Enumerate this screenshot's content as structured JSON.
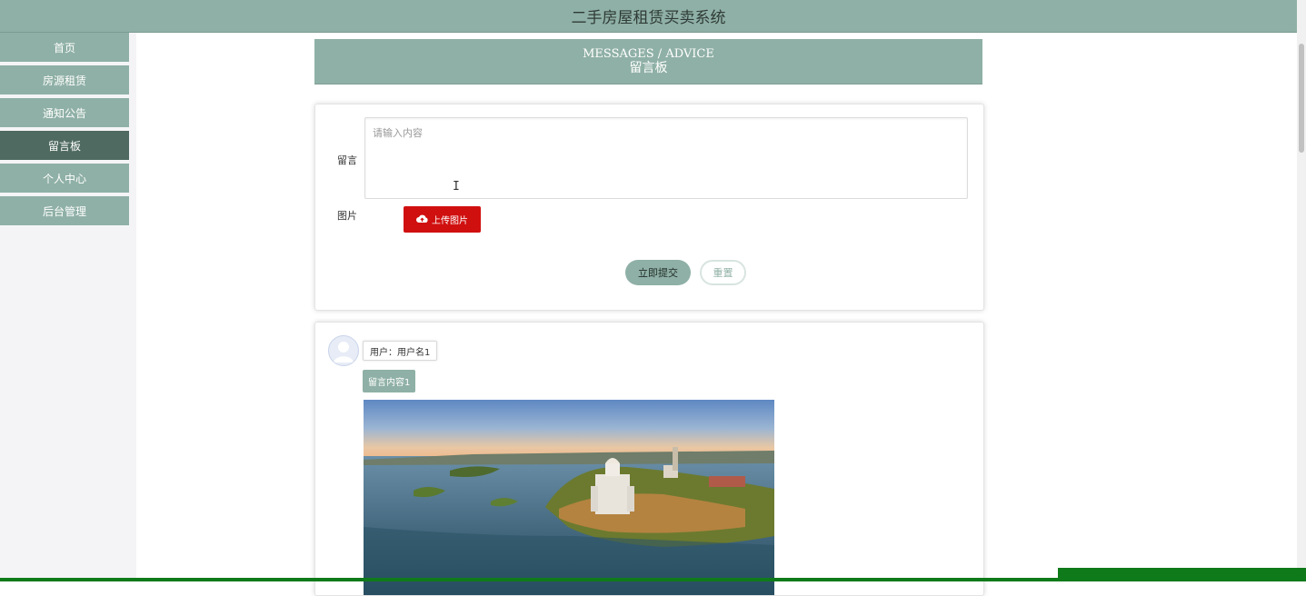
{
  "header": {
    "title": "二手房屋租赁买卖系统"
  },
  "sidebar": {
    "items": [
      {
        "label": "首页",
        "active": false
      },
      {
        "label": "房源租赁",
        "active": false
      },
      {
        "label": "通知公告",
        "active": false
      },
      {
        "label": "留言板",
        "active": true
      },
      {
        "label": "个人中心",
        "active": false
      },
      {
        "label": "后台管理",
        "active": false
      }
    ]
  },
  "banner": {
    "title_en": "MESSAGES / ADVICE",
    "title_cn": "留言板"
  },
  "form": {
    "message_label": "留言",
    "message_placeholder": "请输入内容",
    "image_label": "图片",
    "upload_label": "上传图片",
    "submit_label": "立即提交",
    "reset_label": "重置"
  },
  "messages": [
    {
      "user": "用户：用户名1",
      "content": "留言内容1",
      "image": "landscape-photo"
    }
  ],
  "colors": {
    "accent": "#8fb0a6",
    "active": "#4f6a60",
    "upload": "#d0100f"
  }
}
